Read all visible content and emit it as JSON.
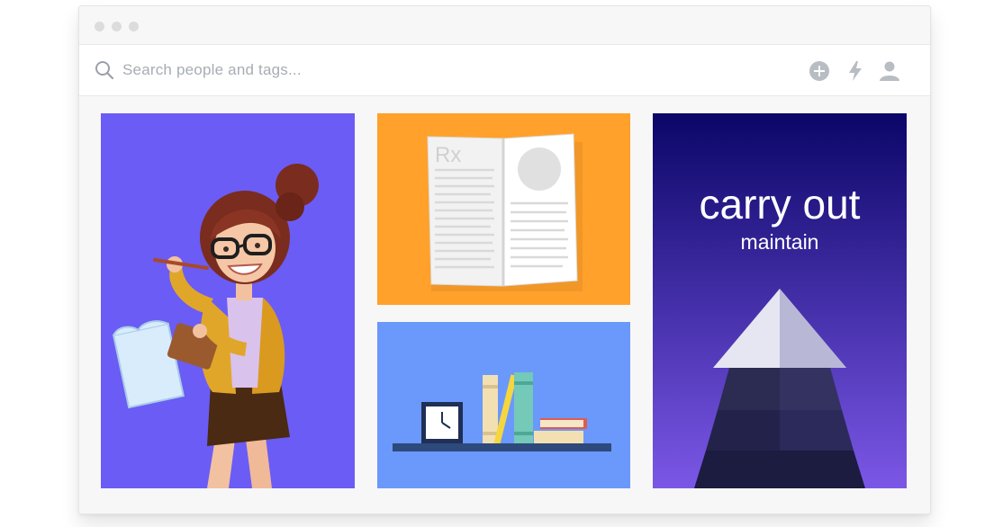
{
  "window": {
    "controls": [
      "close-dot",
      "minimize-dot",
      "maximize-dot"
    ]
  },
  "search": {
    "placeholder": "Search people and tags..."
  },
  "toolbar": {
    "icons": [
      "plus-circle-icon",
      "lightning-icon",
      "user-icon"
    ]
  },
  "cards": {
    "teacher": {
      "bg": "#6b5cf5",
      "illustration": "teacher-illustration"
    },
    "prescription": {
      "bg": "#ffa12b",
      "rx_label": "Rx",
      "illustration": "open-book-illustration"
    },
    "shelf": {
      "bg": "#6a99fb",
      "illustration": "bookshelf-illustration"
    },
    "tree": {
      "bg_top": "#0b0668",
      "bg_bottom": "#7b57e6",
      "headline": "carry out",
      "subline": "maintain",
      "illustration": "tree-illustration"
    }
  }
}
